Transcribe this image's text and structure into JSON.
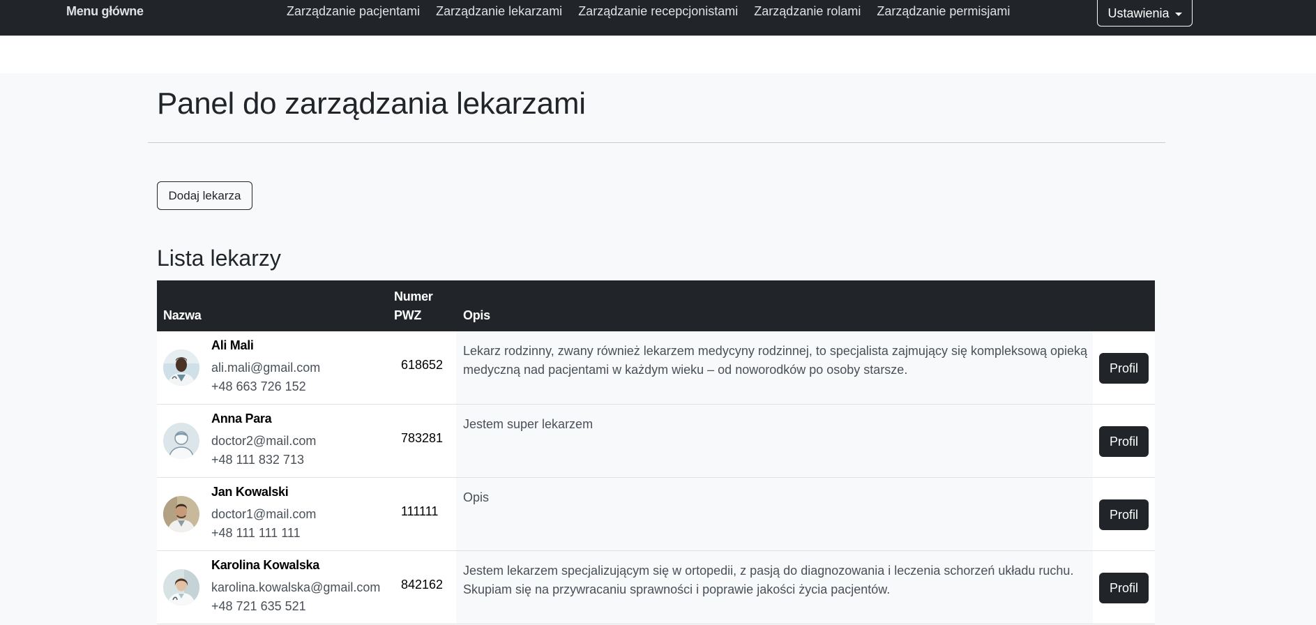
{
  "navbar": {
    "brand": "Menu główne",
    "links": [
      "Zarządzanie pacjentami",
      "Zarządzanie lekarzami",
      "Zarządzanie recepcjonistami",
      "Zarządzanie rolami",
      "Zarządzanie permisjami"
    ],
    "settings_label": "Ustawienia"
  },
  "page": {
    "title": "Panel do zarządzania lekarzami",
    "add_button_label": "Dodaj lekarza",
    "list_title": "Lista lekarzy"
  },
  "table": {
    "headers": {
      "name": "Nazwa",
      "pwz_line1": "Numer",
      "pwz_line2": "PWZ",
      "opis": "Opis"
    },
    "rows": [
      {
        "name": "Ali Mali",
        "email": "ali.mali@gmail.com",
        "phone": "+48 663 726 152",
        "pwz": "618652",
        "opis": "Lekarz rodzinny, zwany również lekarzem medycyny rodzinnej, to specjalista zajmujący się kompleksową opieką medyczną nad pacjentami w każdym wieku – od noworodków po osoby starsze.",
        "button": "Profil",
        "avatar_icon": "doctor-photo-icon"
      },
      {
        "name": "Anna Para",
        "email": "doctor2@mail.com",
        "phone": "+48 111 832 713",
        "pwz": "783281",
        "opis": "Jestem super lekarzem",
        "button": "Profil",
        "avatar_icon": "default-user-icon"
      },
      {
        "name": "Jan Kowalski",
        "email": "doctor1@mail.com",
        "phone": "+48 111 111 111",
        "pwz": "111111",
        "opis": "Opis",
        "button": "Profil",
        "avatar_icon": "doctor-photo-icon"
      },
      {
        "name": "Karolina Kowalska",
        "email": "karolina.kowalska@gmail.com",
        "phone": "+48 721 635 521",
        "pwz": "842162",
        "opis": "Jestem lekarzem specjalizującym się w ortopedii, z pasją do diagnozowania i leczenia schorzeń układu ruchu. Skupiam się na przywracaniu sprawności i poprawie jakości życia pacjentów.",
        "button": "Profil",
        "avatar_icon": "doctor-photo-icon"
      }
    ]
  },
  "colors": {
    "navbar_bg": "#212529",
    "page_bg": "#f8f9fa",
    "button_dark": "#212529"
  }
}
